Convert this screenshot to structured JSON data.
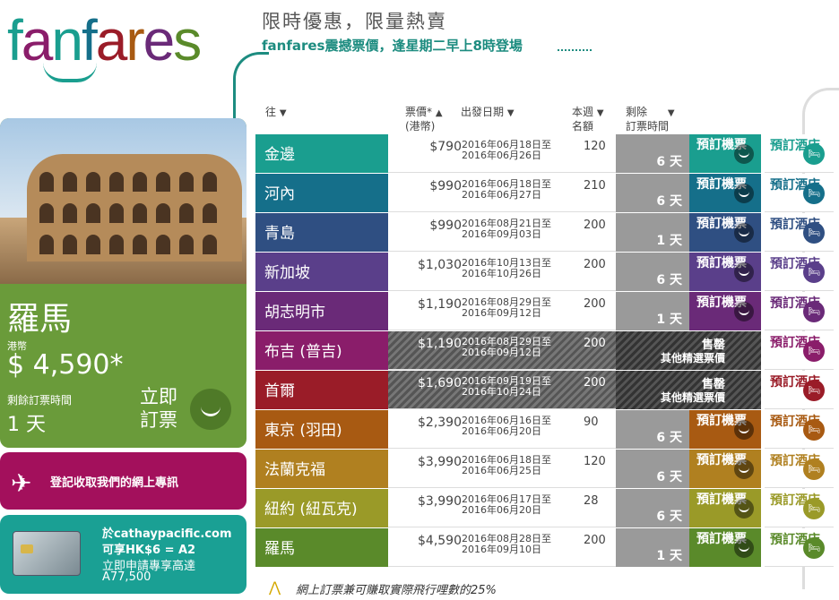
{
  "logo": "fanfares",
  "header": {
    "title": "限時優惠，限量熱賣",
    "subtitle": "fanfares震撼票價，逢星期二早上8時登場"
  },
  "columns": {
    "to": "往",
    "price": "票價*",
    "price_unit": "(港幣)",
    "date": "出發日期",
    "week_l1": "本週",
    "week_l2": "名額",
    "remain_l1": "剩除",
    "remain_l2": "訂票時間"
  },
  "promo": {
    "city": "羅馬",
    "currency": "港幣",
    "price": "$ 4,590*",
    "remain_label": "剩餘訂票時間",
    "remain_value": "1 天",
    "book": "立即訂票"
  },
  "register": {
    "text": "登記收取我們的網上專訊"
  },
  "card": {
    "line1": "於cathaypacific.com",
    "line2": "可享HK$6 = A2",
    "line3": "立即申請專享高達",
    "line4": "A77,500"
  },
  "rows": [
    {
      "city": "金邊",
      "price": "$790",
      "date1": "2016年06月18日至",
      "date2": "2016年06月26日",
      "count": "120",
      "days": "6 天",
      "book": "預訂機票",
      "hotel": "預訂酒店",
      "color": "#1a9e8f",
      "sold": false
    },
    {
      "city": "河內",
      "price": "$990",
      "date1": "2016年06月18日至",
      "date2": "2016年06月27日",
      "count": "210",
      "days": "6 天",
      "book": "預訂機票",
      "hotel": "預訂酒店",
      "color": "#156f8a",
      "sold": false
    },
    {
      "city": "青島",
      "price": "$990",
      "date1": "2016年08月21日至",
      "date2": "2016年09月03日",
      "count": "200",
      "days": "1 天",
      "book": "預訂機票",
      "hotel": "預訂酒店",
      "color": "#2f4f82",
      "sold": false
    },
    {
      "city": "新加坡",
      "price": "$1,030",
      "date1": "2016年10月13日至",
      "date2": "2016年10月26日",
      "count": "200",
      "days": "6 天",
      "book": "預訂機票",
      "hotel": "預訂酒店",
      "color": "#5a3f8a",
      "sold": false
    },
    {
      "city": "胡志明市",
      "price": "$1,190",
      "date1": "2016年08月29日至",
      "date2": "2016年09月12日",
      "count": "200",
      "days": "1 天",
      "book": "預訂機票",
      "hotel": "預訂酒店",
      "color": "#6a2a78",
      "sold": false
    },
    {
      "city": "布吉 (普吉)",
      "price": "$1,190",
      "date1": "2016年08月29日至",
      "date2": "2016年09月12日",
      "count": "200",
      "days": "",
      "book": "",
      "hotel": "預訂酒店",
      "color": "#8a1d6a",
      "sold": true,
      "sold_a": "售罄",
      "sold_b": "其他精選票價"
    },
    {
      "city": "首爾",
      "price": "$1,690",
      "date1": "2016年09月19日至",
      "date2": "2016年10月24日",
      "count": "200",
      "days": "",
      "book": "",
      "hotel": "預訂酒店",
      "color": "#9a1c28",
      "sold": true,
      "sold_a": "售罄",
      "sold_b": "其他精選票價"
    },
    {
      "city": "東京 (羽田)",
      "price": "$2,390",
      "date1": "2016年06月16日至",
      "date2": "2016年06月20日",
      "count": "90",
      "days": "6 天",
      "book": "預訂機票",
      "hotel": "預訂酒店",
      "color": "#a85a12",
      "sold": false
    },
    {
      "city": "法蘭克福",
      "price": "$3,990",
      "date1": "2016年06月18日至",
      "date2": "2016年06月25日",
      "count": "120",
      "days": "6 天",
      "book": "預訂機票",
      "hotel": "預訂酒店",
      "color": "#b08020",
      "sold": false
    },
    {
      "city": "紐約 (紐瓦克)",
      "price": "$3,990",
      "date1": "2016年06月17日至",
      "date2": "2016年06月20日",
      "count": "28",
      "days": "6 天",
      "book": "預訂機票",
      "hotel": "預訂酒店",
      "color": "#9a9a28",
      "sold": false
    },
    {
      "city": "羅馬",
      "price": "$4,590",
      "date1": "2016年08月28日至",
      "date2": "2016年09月10日",
      "count": "200",
      "days": "1 天",
      "book": "預訂機票",
      "hotel": "預訂酒店",
      "color": "#5a8a2a",
      "sold": false
    }
  ],
  "footer": "網上訂票兼可賺取實際飛行哩數的25%"
}
